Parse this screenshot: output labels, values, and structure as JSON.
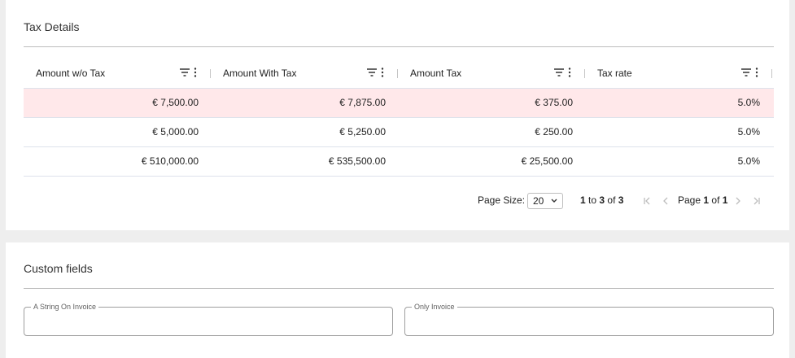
{
  "tax_details": {
    "title": "Tax Details",
    "columns": [
      {
        "label": "Amount w/o Tax"
      },
      {
        "label": "Amount With Tax"
      },
      {
        "label": "Amount Tax"
      },
      {
        "label": "Tax rate"
      }
    ],
    "rows": [
      {
        "amount_wo_tax": "€ 7,500.00",
        "amount_with_tax": "€ 7,875.00",
        "amount_tax": "€ 375.00",
        "tax_rate": "5.0%",
        "highlighted": true
      },
      {
        "amount_wo_tax": "€ 5,000.00",
        "amount_with_tax": "€ 5,250.00",
        "amount_tax": "€ 250.00",
        "tax_rate": "5.0%",
        "highlighted": false
      },
      {
        "amount_wo_tax": "€ 510,000.00",
        "amount_with_tax": "€ 535,500.00",
        "amount_tax": "€ 25,500.00",
        "tax_rate": "5.0%",
        "highlighted": false
      }
    ],
    "pagination": {
      "page_size_label": "Page Size:",
      "page_size_value": "20",
      "range_from": "1",
      "range_to_word": "to",
      "range_to": "3",
      "range_of_word": "of",
      "range_total": "3",
      "page_word": "Page",
      "page_current": "1",
      "page_of_word": "of",
      "page_total": "1"
    }
  },
  "custom_fields": {
    "title": "Custom fields",
    "fields": [
      {
        "label": "A String On Invoice",
        "value": ""
      },
      {
        "label": "Only Invoice",
        "value": ""
      }
    ]
  },
  "colors": {
    "highlight_row": "#ffe8ea",
    "page_background": "#eeeeee",
    "card_background": "#ffffff"
  }
}
